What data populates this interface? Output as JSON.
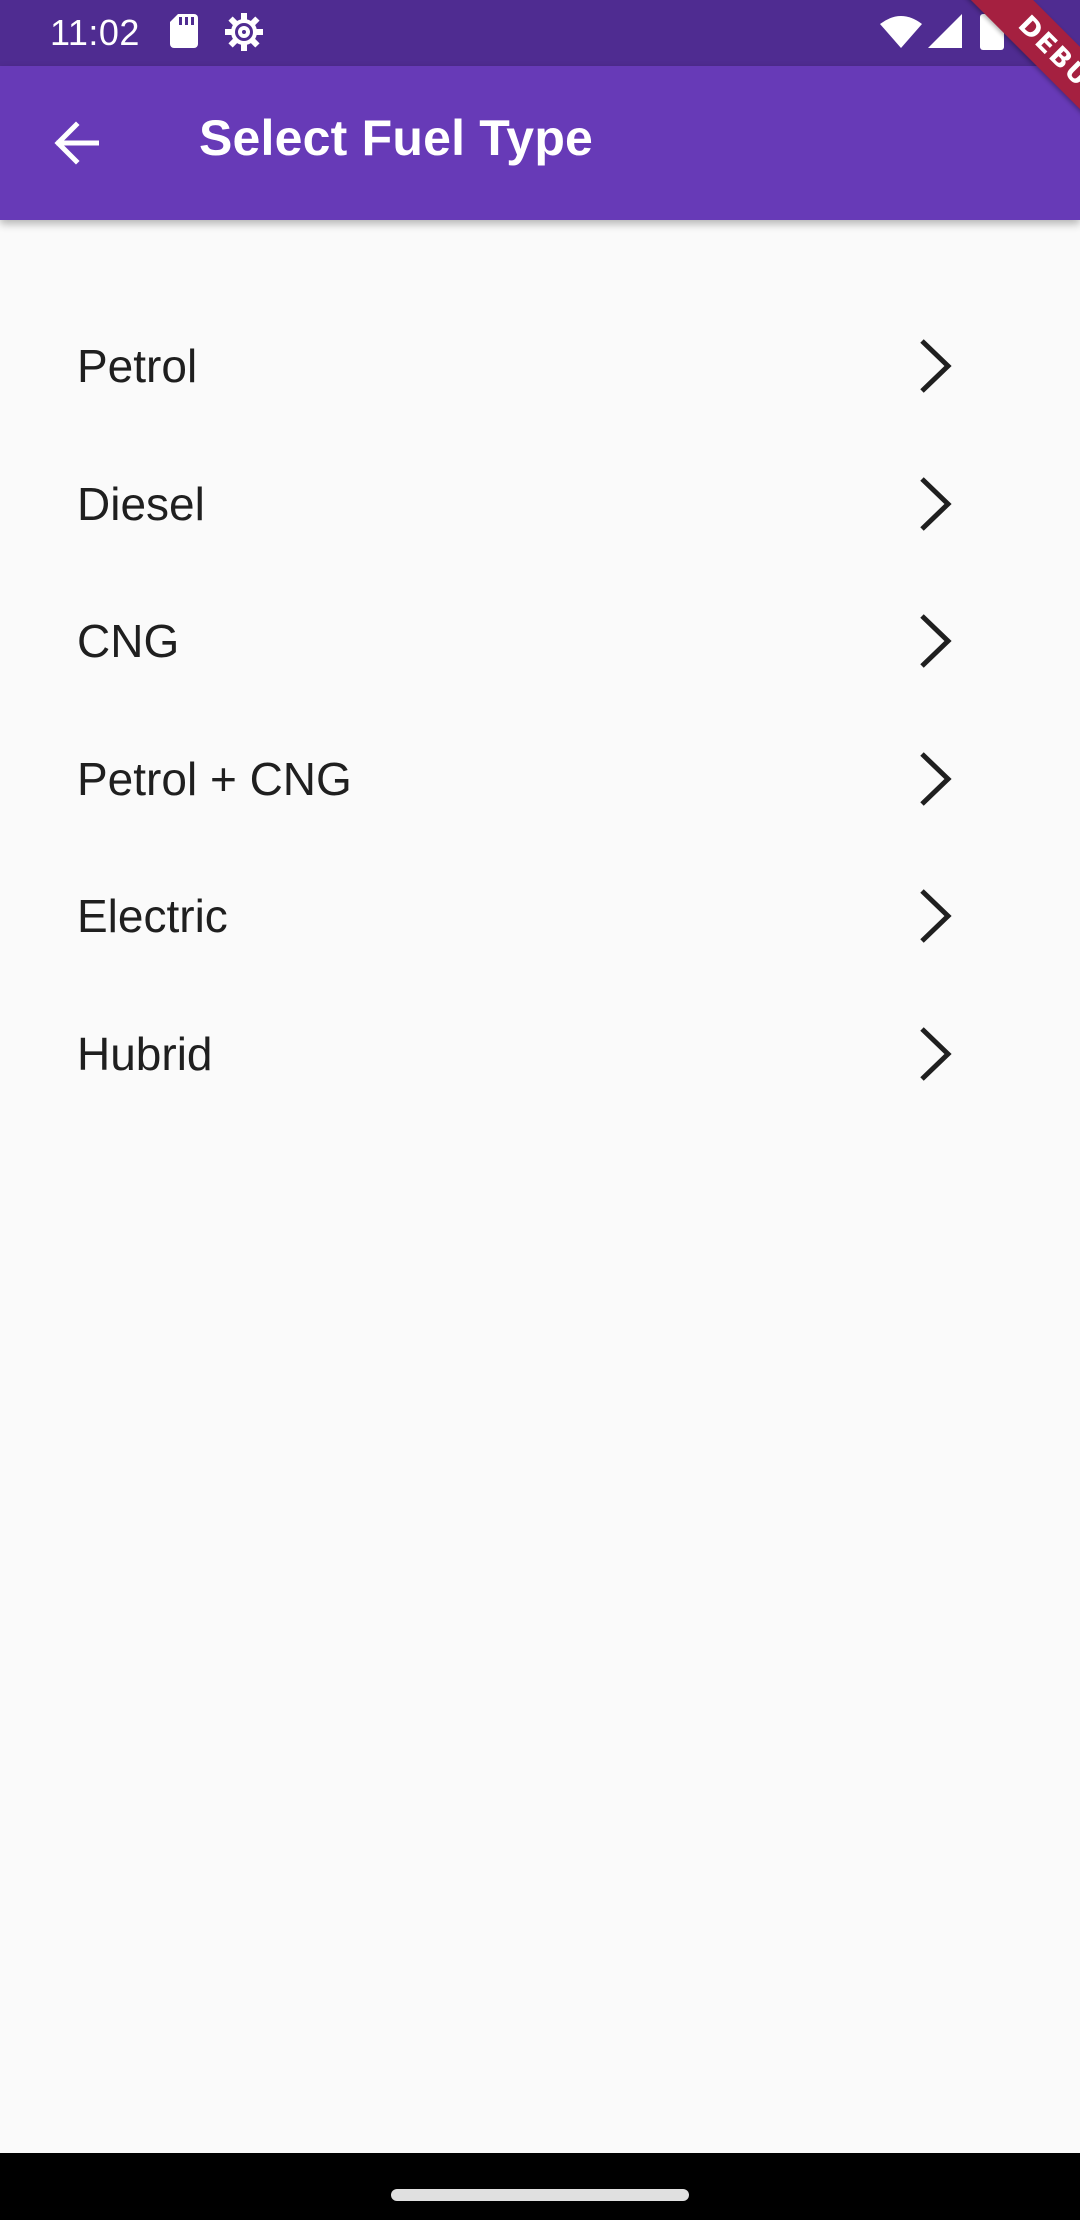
{
  "status_bar": {
    "time": "11:02",
    "icons": [
      "sd-card-icon",
      "settings-gear-icon",
      "wifi-icon",
      "signal-icon",
      "battery-icon"
    ]
  },
  "app_bar": {
    "title": "Select Fuel Type",
    "back_icon": "arrow-back-icon",
    "color": "#673ab7"
  },
  "debug_banner": {
    "label": "DEBUG"
  },
  "fuel_types": [
    {
      "label": "Petrol"
    },
    {
      "label": "Diesel"
    },
    {
      "label": "CNG"
    },
    {
      "label": "Petrol + CNG"
    },
    {
      "label": "Electric"
    },
    {
      "label": "Hubrid"
    }
  ],
  "colors": {
    "status_bar": "#4f2c91",
    "app_bar": "#673ab7",
    "background": "#fafafa",
    "text": "#1f1f1f",
    "debug_ribbon": "#a52040"
  }
}
